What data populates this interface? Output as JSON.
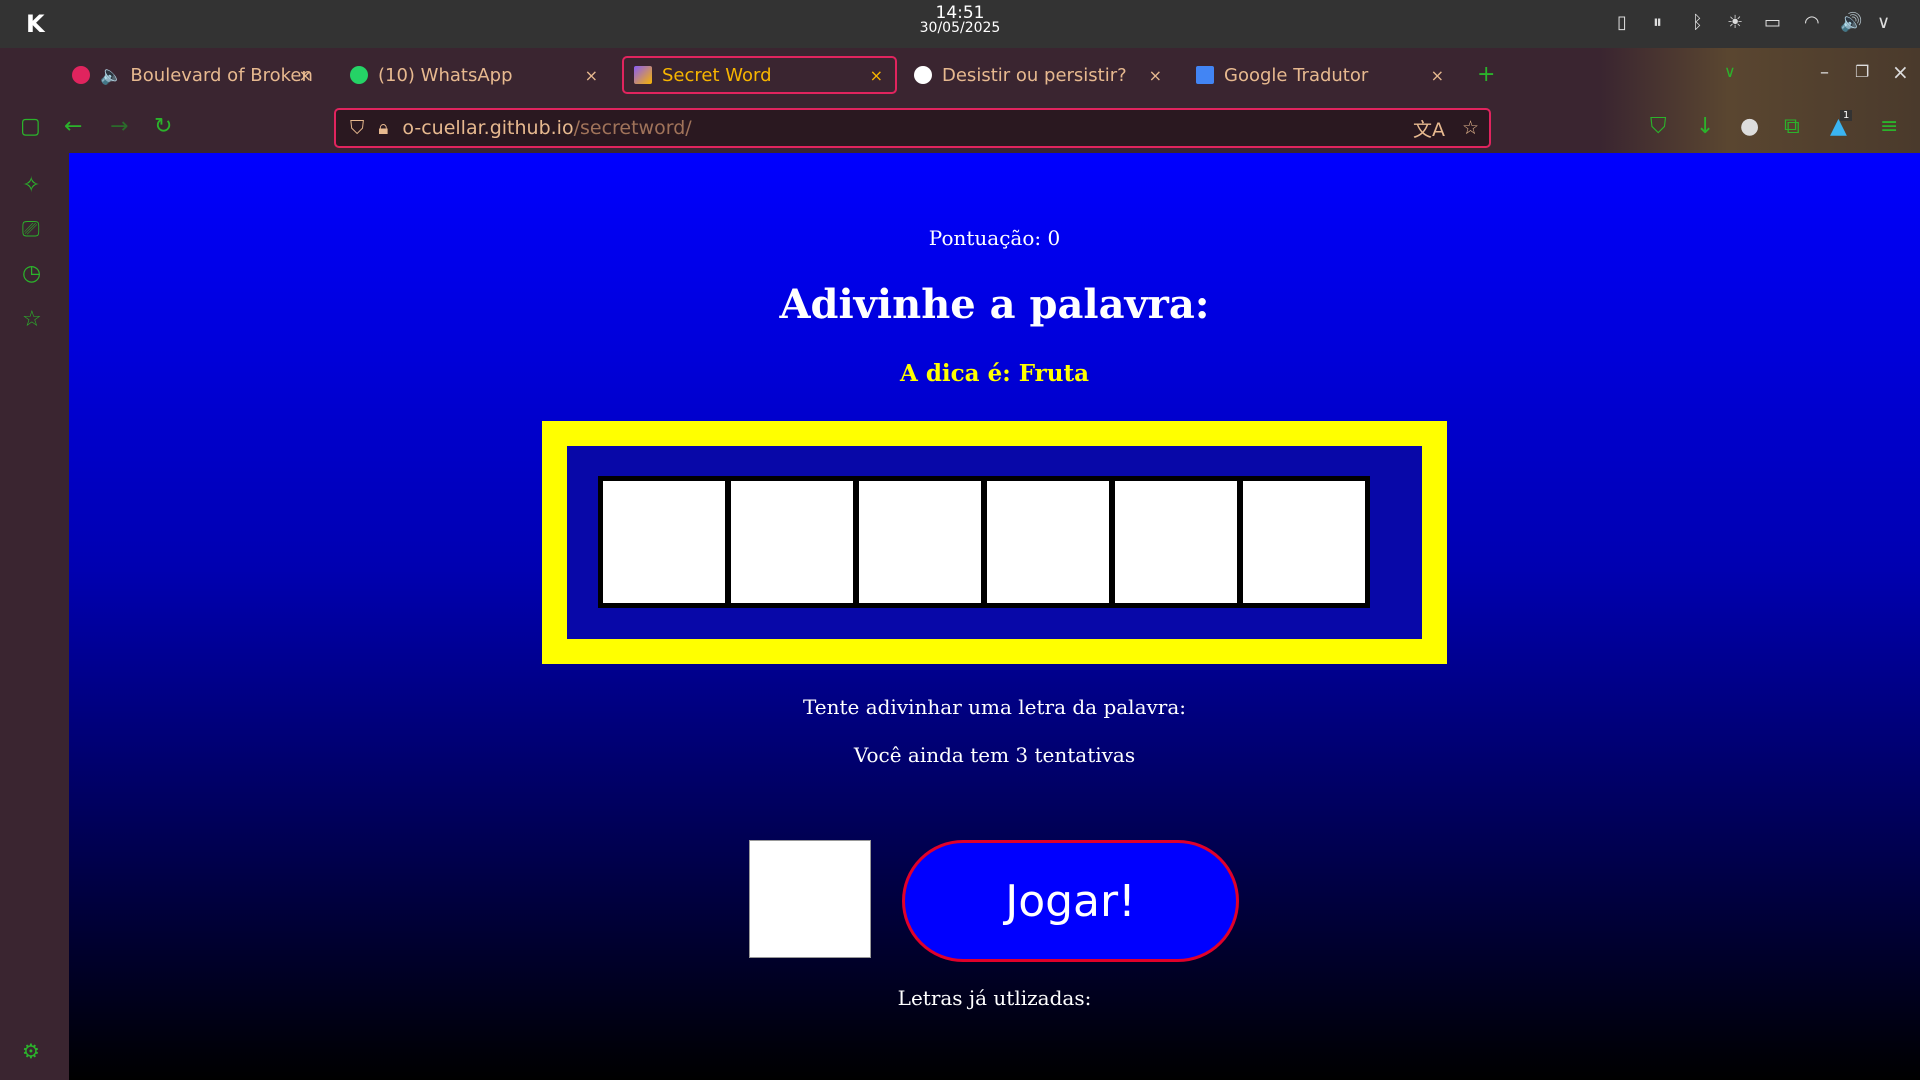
{
  "system": {
    "time": "14:51",
    "date": "30/05/2025"
  },
  "tabs": [
    {
      "label": "Boulevard of Broken",
      "active": false
    },
    {
      "label": "(10) WhatsApp",
      "active": false
    },
    {
      "label": "Secret Word",
      "active": true
    },
    {
      "label": "Desistir ou persistir?",
      "active": false
    },
    {
      "label": "Google Tradutor",
      "active": false
    }
  ],
  "url": {
    "host": "o-cuellar.github.io",
    "path": "/secretword/"
  },
  "extension_badge": "1",
  "game": {
    "score_text": "Pontuação: 0",
    "title": "Adivinhe a palavra:",
    "hint": "A dica é: Fruta",
    "letters": [
      "",
      "",
      "",
      "",
      "",
      ""
    ],
    "prompt": "Tente adivinhar uma letra da palavra:",
    "attempts": "Você ainda tem 3 tentativas",
    "letter_input": "",
    "play_button": "Jogar!",
    "used_letters_label": "Letras já utlizadas:"
  },
  "colors": {
    "accent": "#e0245e",
    "board_border": "#ffff00",
    "hint": "#ffff00"
  }
}
